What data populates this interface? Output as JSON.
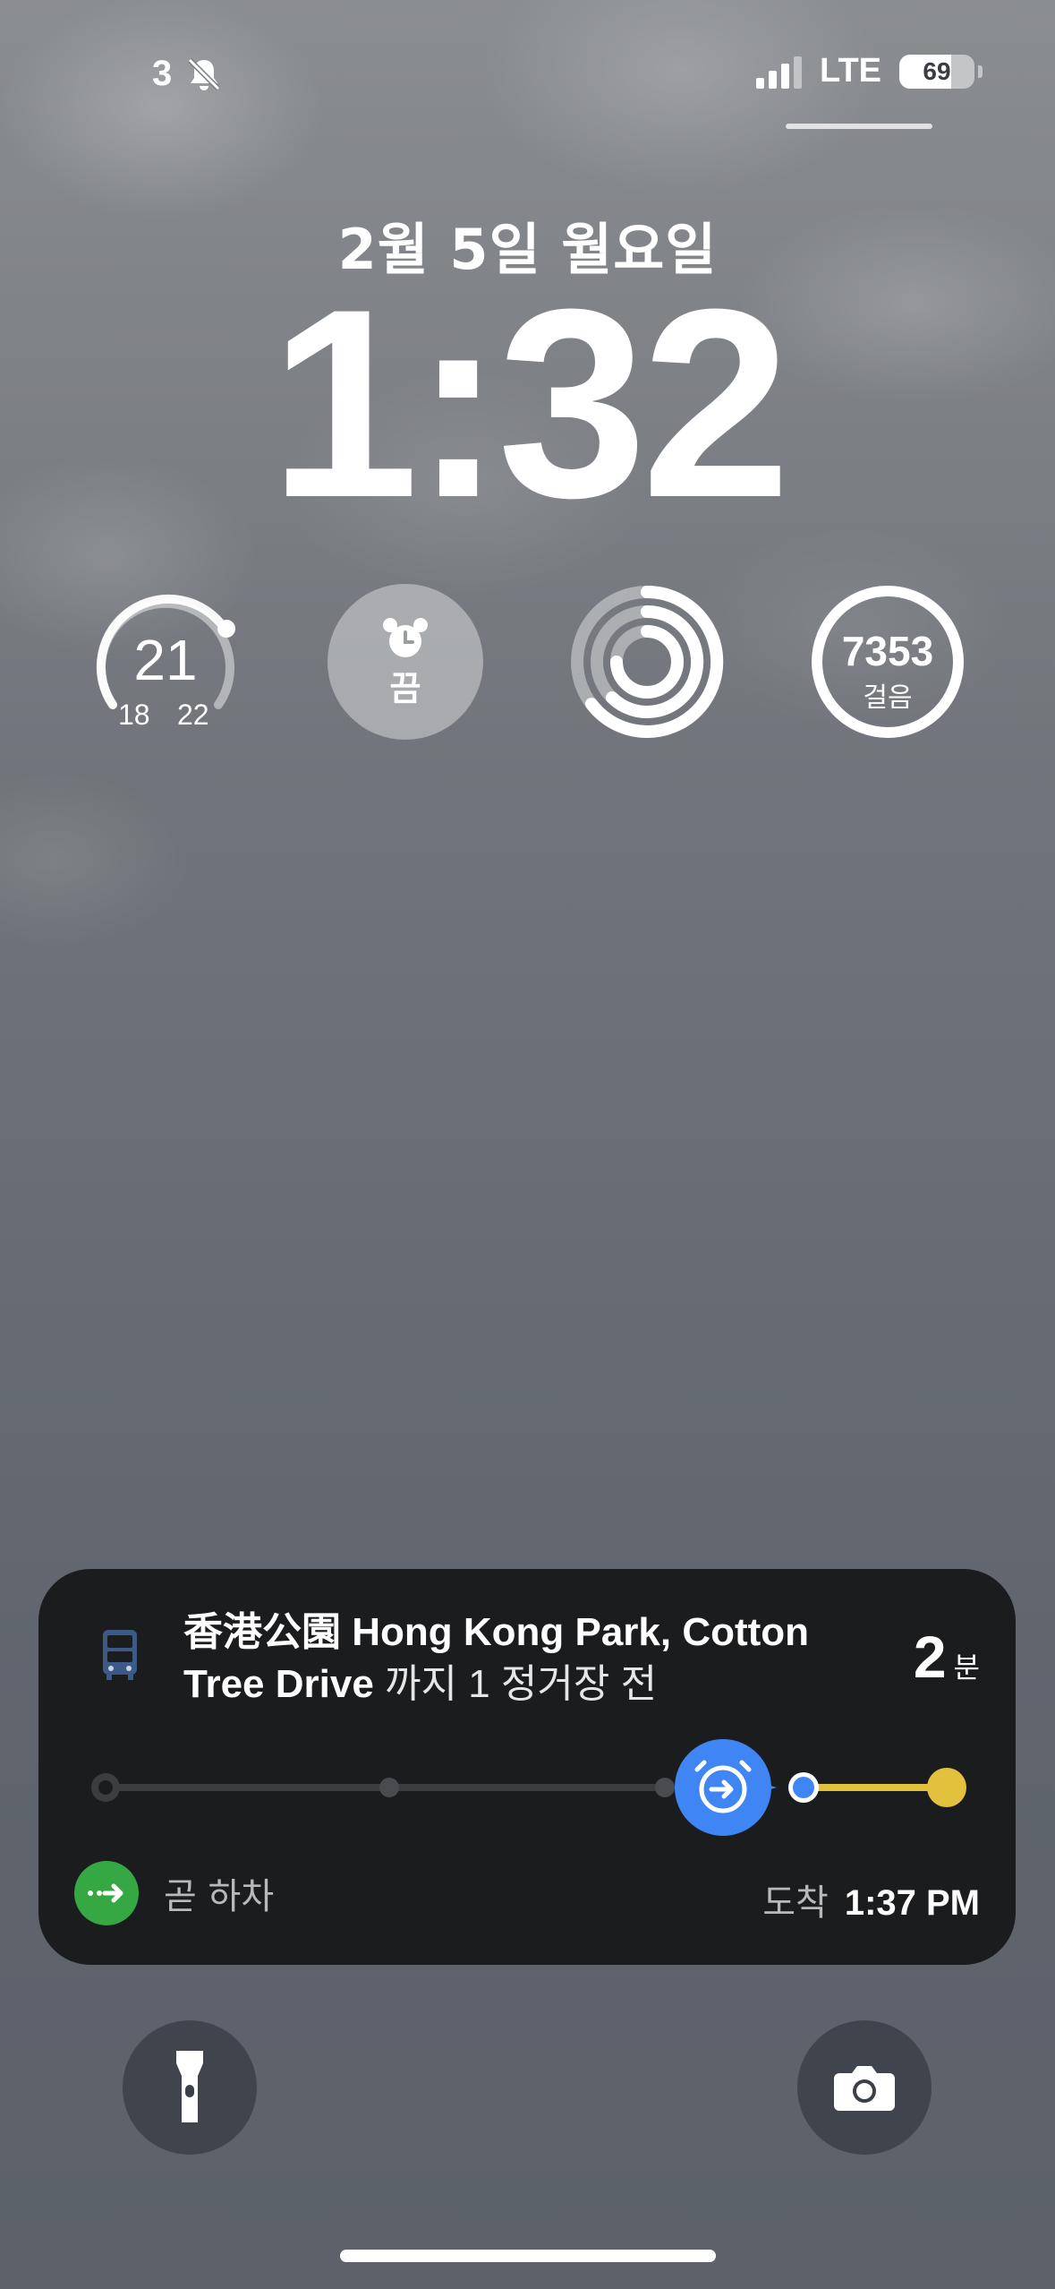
{
  "status_bar": {
    "left_count": "3",
    "network": "LTE",
    "battery": "69"
  },
  "lockscreen": {
    "date": "2월 5일 월요일",
    "time": "1:32"
  },
  "widgets": {
    "weather": {
      "temp": "21",
      "low": "18",
      "high": "22"
    },
    "alarm": {
      "label": "끔"
    },
    "activity": {
      "icon": "activity-rings-icon"
    },
    "steps": {
      "value": "7353",
      "unit": "걸음"
    }
  },
  "live_activity": {
    "stop_name_line1": "香港公園  Hong Kong Park, Cotton",
    "stop_name_bold2": "Tree Drive",
    "stop_suffix": " 까지 1 정거장 전",
    "eta_value": "2",
    "eta_unit": "분",
    "exit_label": "곧 하차",
    "arrive_label": "도착",
    "arrive_time": "1:37 PM",
    "colors": {
      "upcoming_route": "#e2c13d",
      "current": "#3f86f4",
      "exit": "#35a743"
    }
  },
  "quick_actions": {
    "left": "flashlight-icon",
    "right": "camera-icon"
  }
}
